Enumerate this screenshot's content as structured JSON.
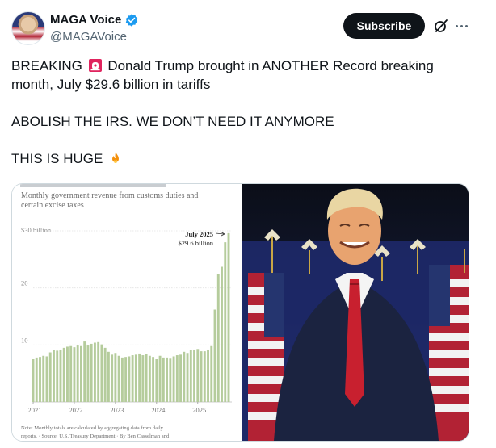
{
  "post": {
    "display_name": "MAGA Voice",
    "handle": "@MAGAVoice",
    "subscribe_label": "Subscribe",
    "icons": {
      "verified": "verified-badge-icon",
      "grok": "grok-icon",
      "more": "more-icon"
    },
    "text": {
      "line1_a": "BREAKING",
      "line1_b": "Donald Trump brought in ANOTHER Record breaking",
      "line2": "month, July $29.6 billion in tariffs",
      "line3": "ABOLISH THE IRS. WE DON’T NEED IT ANYMORE",
      "line4": "THIS IS HUGE",
      "emoji1": "siren-emoji",
      "emoji2": "fire-emoji"
    }
  },
  "colors": {
    "verified_blue": "#1d9bf0",
    "bar_green": "#b5cc9c",
    "text_dark": "#0f1419",
    "text_muted": "#536471"
  },
  "chart_data": {
    "type": "bar",
    "subtitle": "Monthly government revenue from customs duties and certain excise taxes",
    "ylabel_top": "$30 billion",
    "y_ticks": [
      10,
      20
    ],
    "ylim": [
      0,
      30
    ],
    "x_tick_labels": [
      "2021",
      "2022",
      "2023",
      "2024",
      "2025"
    ],
    "annotation": {
      "label": "July 2025",
      "value_label": "$29.6 billion"
    },
    "note": "Note: Monthly totals are calculated by aggregating data from daily reports. · Source: U.S. Treasury Department · By Ben Casselman and",
    "months_start": "2021-01",
    "values": [
      7.5,
      7.8,
      7.9,
      8.1,
      8.0,
      8.7,
      9.1,
      9.0,
      9.2,
      9.5,
      9.7,
      9.8,
      9.6,
      9.9,
      9.8,
      10.6,
      9.9,
      10.2,
      10.4,
      10.5,
      10.1,
      9.5,
      8.8,
      8.3,
      8.6,
      8.1,
      7.8,
      7.9,
      8.0,
      8.2,
      8.3,
      8.5,
      8.2,
      8.4,
      8.1,
      7.9,
      7.5,
      8.1,
      7.8,
      7.8,
      7.6,
      8.0,
      8.2,
      8.3,
      8.8,
      8.6,
      9.1,
      9.2,
      9.3,
      8.9,
      8.9,
      9.2,
      9.8,
      16.2,
      22.5,
      23.7,
      28.0,
      29.6
    ]
  }
}
